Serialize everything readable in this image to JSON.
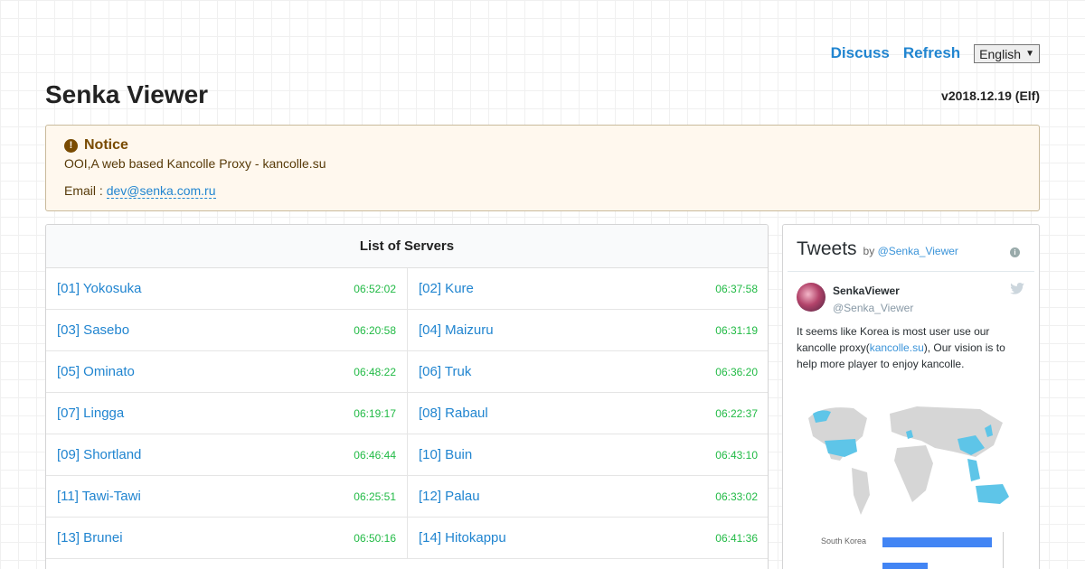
{
  "nav": {
    "discuss": "Discuss",
    "refresh": "Refresh",
    "language": "English"
  },
  "header": {
    "title": "Senka Viewer",
    "version": "v2018.12.19 (Elf)"
  },
  "notice": {
    "heading": "Notice",
    "line1": "OOI,A web based Kancolle Proxy - kancolle.su",
    "email_label": "Email :",
    "email": "dev@senka.com.ru"
  },
  "servers": {
    "heading": "List of Servers",
    "items": [
      {
        "name": "[01] Yokosuka",
        "time": "06:52:02"
      },
      {
        "name": "[02] Kure",
        "time": "06:37:58"
      },
      {
        "name": "[03] Sasebo",
        "time": "06:20:58"
      },
      {
        "name": "[04] Maizuru",
        "time": "06:31:19"
      },
      {
        "name": "[05] Ominato",
        "time": "06:48:22"
      },
      {
        "name": "[06] Truk",
        "time": "06:36:20"
      },
      {
        "name": "[07] Lingga",
        "time": "06:19:17"
      },
      {
        "name": "[08] Rabaul",
        "time": "06:22:37"
      },
      {
        "name": "[09] Shortland",
        "time": "06:46:44"
      },
      {
        "name": "[10] Buin",
        "time": "06:43:10"
      },
      {
        "name": "[11] Tawi-Tawi",
        "time": "06:25:51"
      },
      {
        "name": "[12] Palau",
        "time": "06:33:02"
      },
      {
        "name": "[13] Brunei",
        "time": "06:50:16"
      },
      {
        "name": "[14] Hitokappu",
        "time": "06:41:36"
      }
    ]
  },
  "tweets": {
    "title": "Tweets",
    "by": "by",
    "by_handle": "@Senka_Viewer",
    "user_name": "SenkaViewer",
    "user_handle": "@Senka_Viewer",
    "text_before": "It seems like Korea is most user use our kancolle proxy(",
    "text_link": "kancolle.su",
    "text_after": "), Our vision is to help more player to enjoy kancolle.",
    "chart_label": "South Korea"
  },
  "colors": {
    "accent": "#2185d0",
    "time": "#21ba45",
    "notice_bg": "#fff8ee",
    "bar": "#4285f4"
  }
}
